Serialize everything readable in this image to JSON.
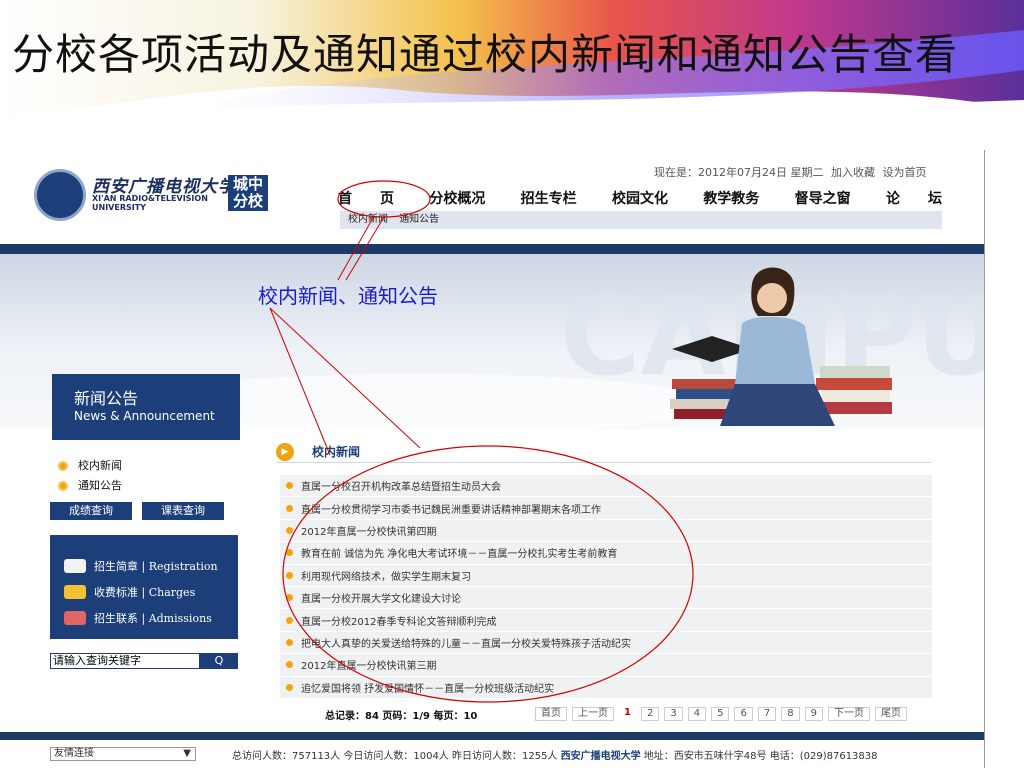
{
  "slide": {
    "title": "分校各项活动及通知通过校内新闻和通知公告查看",
    "annotation": "校内新闻、通知公告"
  },
  "header": {
    "logo_cn": "西安广播电视大学",
    "logo_en": "XI'AN RADIO&TELEVISION UNIVERSITY",
    "campus_badge": "城中分校",
    "date_text": "现在是：2012年07月24日 星期二",
    "bookmark": "加入收藏",
    "set_home": "设为首页"
  },
  "nav": [
    "首　　页",
    "分校概况",
    "招生专栏",
    "校园文化",
    "教学教务",
    "督导之窗",
    "论　　坛"
  ],
  "subnav": [
    "校内新闻",
    "通知公告"
  ],
  "sidebar": {
    "news_title_cn": "新闻公告",
    "news_title_en": "News & Announcement",
    "links": [
      "校内新闻",
      "通知公告"
    ],
    "query_buttons": [
      "成绩查询",
      "课表查询"
    ],
    "services": [
      "招生简章 | Registration",
      "收费标准 | Charges",
      "招生联系 | Admissions"
    ],
    "search_placeholder": "请输入查询关键字",
    "search_button": "Q"
  },
  "section": {
    "title": "校内新闻",
    "items": [
      "直属一分校召开机构改革总结暨招生动员大会",
      "直属一分校贯彻学习市委书记魏民洲重要讲话精神部署期末各项工作",
      "2012年直属一分校快讯第四期",
      "教育在前 诚信为先 净化电大考试环境－－直属一分校扎实考生考前教育",
      "利用现代网络技术，做实学生期末复习",
      "直属一分校开展大学文化建设大讨论",
      "直属一分校2012春季专科论文答辩顺利完成",
      "把电大人真挚的关爱送给特殊的儿童－－直属一分校关爱特殊孩子活动纪实",
      "2012年直属一分校快讯第三期",
      "追忆爱国将领 抒发爱国情怀－－直属一分校班级活动纪实"
    ]
  },
  "pager": {
    "summary": "总记录：84 页码：1/9 每页：10",
    "first": "首页",
    "prev": "上一页",
    "pages": [
      "1",
      "2",
      "3",
      "4",
      "5",
      "6",
      "7",
      "8",
      "9"
    ],
    "current": "1",
    "next": "下一页",
    "last": "尾页"
  },
  "footer": {
    "friend_links": "友情连接",
    "stats": "总访问人数：757113人 今日访问人数：1004人 昨日访问人数：1255人",
    "university": "西安广播电视大学",
    "address": "地址：西安市五味什字48号 电话：(029)87613838"
  },
  "colors": {
    "brand_blue": "#1c3f7a",
    "accent_orange": "#f1a411",
    "annotation_red": "#d40000",
    "annotation_text": "#1a1ad0"
  }
}
